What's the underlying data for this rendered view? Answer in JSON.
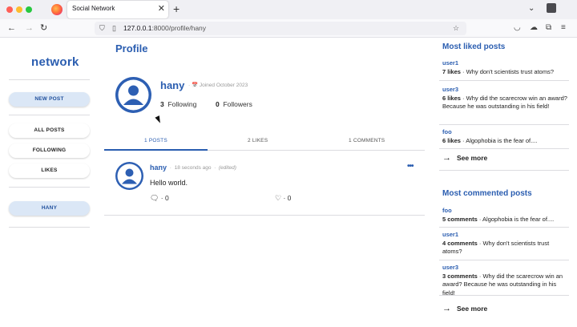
{
  "browser": {
    "tab_title": "Social Network",
    "tab_close": "✕",
    "new_tab": "+",
    "url_host": "127.0.0.1",
    "url_path": ":8000/profile/hany",
    "colors": {
      "close": "#ff5f57",
      "minimize": "#febc2e",
      "maximize": "#28c840"
    }
  },
  "sidebar": {
    "logo": "network",
    "new_post": "NEW POST",
    "nav": [
      "ALL POSTS",
      "FOLLOWING",
      "LIKES"
    ],
    "user_chip": "HANY"
  },
  "profile": {
    "title": "Profile",
    "username": "hany",
    "joined": "Joined October 2023",
    "following_count": "3",
    "following_label": "Following",
    "followers_count": "0",
    "followers_label": "Followers"
  },
  "tabs": [
    {
      "label": "1 POSTS",
      "active": true
    },
    {
      "label": "2 LIKES",
      "active": false
    },
    {
      "label": "1 COMMENTS",
      "active": false
    }
  ],
  "post": {
    "user": "hany",
    "time": "18 seconds ago",
    "edited": "(edited)",
    "body": "Hello world.",
    "comments": "0",
    "likes": "0"
  },
  "most_liked": {
    "title": "Most liked posts",
    "items": [
      {
        "user": "user1",
        "count": "7 likes",
        "text": "Why don't scientists trust atoms?"
      },
      {
        "user": "user3",
        "count": "6 likes",
        "text": "Why did the scarecrow win an award? Because he was outstanding in his field!"
      },
      {
        "user": "foo",
        "count": "6 likes",
        "text": "Algophobia is the fear of...."
      }
    ],
    "see_more": "See more"
  },
  "most_commented": {
    "title": "Most commented posts",
    "items": [
      {
        "user": "foo",
        "count": "5 comments",
        "text": "Algophobia is the fear of...."
      },
      {
        "user": "user1",
        "count": "4 comments",
        "text": "Why don't scientists trust atoms?"
      },
      {
        "user": "user3",
        "count": "3 comments",
        "text": "Why did the scarecrow win an award? Because he was outstanding in his field!"
      }
    ],
    "see_more": "See more"
  }
}
